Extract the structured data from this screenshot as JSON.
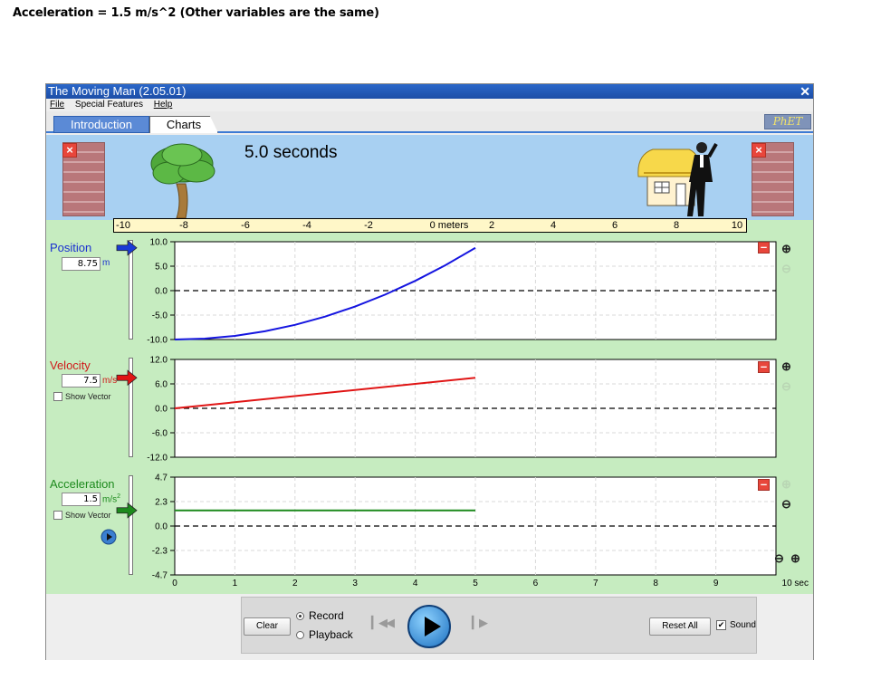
{
  "caption": "Acceleration = 1.5 m/s^2 (Other variables are the same)",
  "window": {
    "title": "The Moving Man (2.05.01)",
    "close_icon": "close-icon"
  },
  "menu": {
    "file": "File",
    "special": "Special Features",
    "help": "Help"
  },
  "tabs": {
    "intro": "Introduction",
    "charts": "Charts"
  },
  "phet_logo": "PhET",
  "scene": {
    "time": "5.0 seconds",
    "ruler_labels": [
      "-10",
      "-8",
      "-6",
      "-4",
      "-2",
      "0 meters",
      "2",
      "4",
      "6",
      "8",
      "10"
    ],
    "wall_close": "×"
  },
  "position": {
    "title": "Position",
    "value": "8.75",
    "unit": "m",
    "color": "#1515e0",
    "yticks": [
      "10.0",
      "5.0",
      "0.0",
      "-5.0",
      "-10.0"
    ]
  },
  "velocity": {
    "title": "Velocity",
    "value": "7.5",
    "unit": "m/s",
    "color": "#e01515",
    "show_vector": "Show Vector",
    "yticks": [
      "12.0",
      "6.0",
      "0.0",
      "-6.0",
      "-12.0"
    ]
  },
  "acceleration": {
    "title": "Acceleration",
    "value": "1.5",
    "unit": "m/s",
    "unit_sup": "2",
    "color": "#1d8a1d",
    "show_vector": "Show Vector",
    "yticks": [
      "4.7",
      "2.3",
      "0.0",
      "-2.3",
      "-4.7"
    ]
  },
  "time_axis": {
    "ticks": [
      "0",
      "1",
      "2",
      "3",
      "4",
      "5",
      "6",
      "7",
      "8",
      "9"
    ],
    "end_label": "10 sec"
  },
  "controls": {
    "clear": "Clear",
    "record": "Record",
    "playback": "Playback",
    "reset": "Reset All",
    "sound": "Sound"
  },
  "chart_data": [
    {
      "type": "line",
      "title": "",
      "ylabel": "Position",
      "xlim": [
        0,
        10
      ],
      "ylim": [
        -10,
        10
      ],
      "series": [
        {
          "x": [
            0,
            0.5,
            1,
            1.5,
            2,
            2.5,
            3,
            3.5,
            4,
            4.5,
            5
          ],
          "values": [
            -10,
            -9.81,
            -9.25,
            -8.31,
            -7,
            -5.31,
            -3.25,
            -0.81,
            2,
            5.19,
            8.75
          ]
        }
      ]
    },
    {
      "type": "line",
      "title": "",
      "ylabel": "Velocity",
      "xlim": [
        0,
        10
      ],
      "ylim": [
        -12,
        12
      ],
      "series": [
        {
          "x": [
            0,
            5
          ],
          "values": [
            0,
            7.5
          ]
        }
      ]
    },
    {
      "type": "line",
      "title": "",
      "ylabel": "Acceleration",
      "xlim": [
        0,
        10
      ],
      "ylim": [
        -4.7,
        4.7
      ],
      "series": [
        {
          "x": [
            0,
            5
          ],
          "values": [
            1.5,
            1.5
          ]
        }
      ]
    }
  ]
}
